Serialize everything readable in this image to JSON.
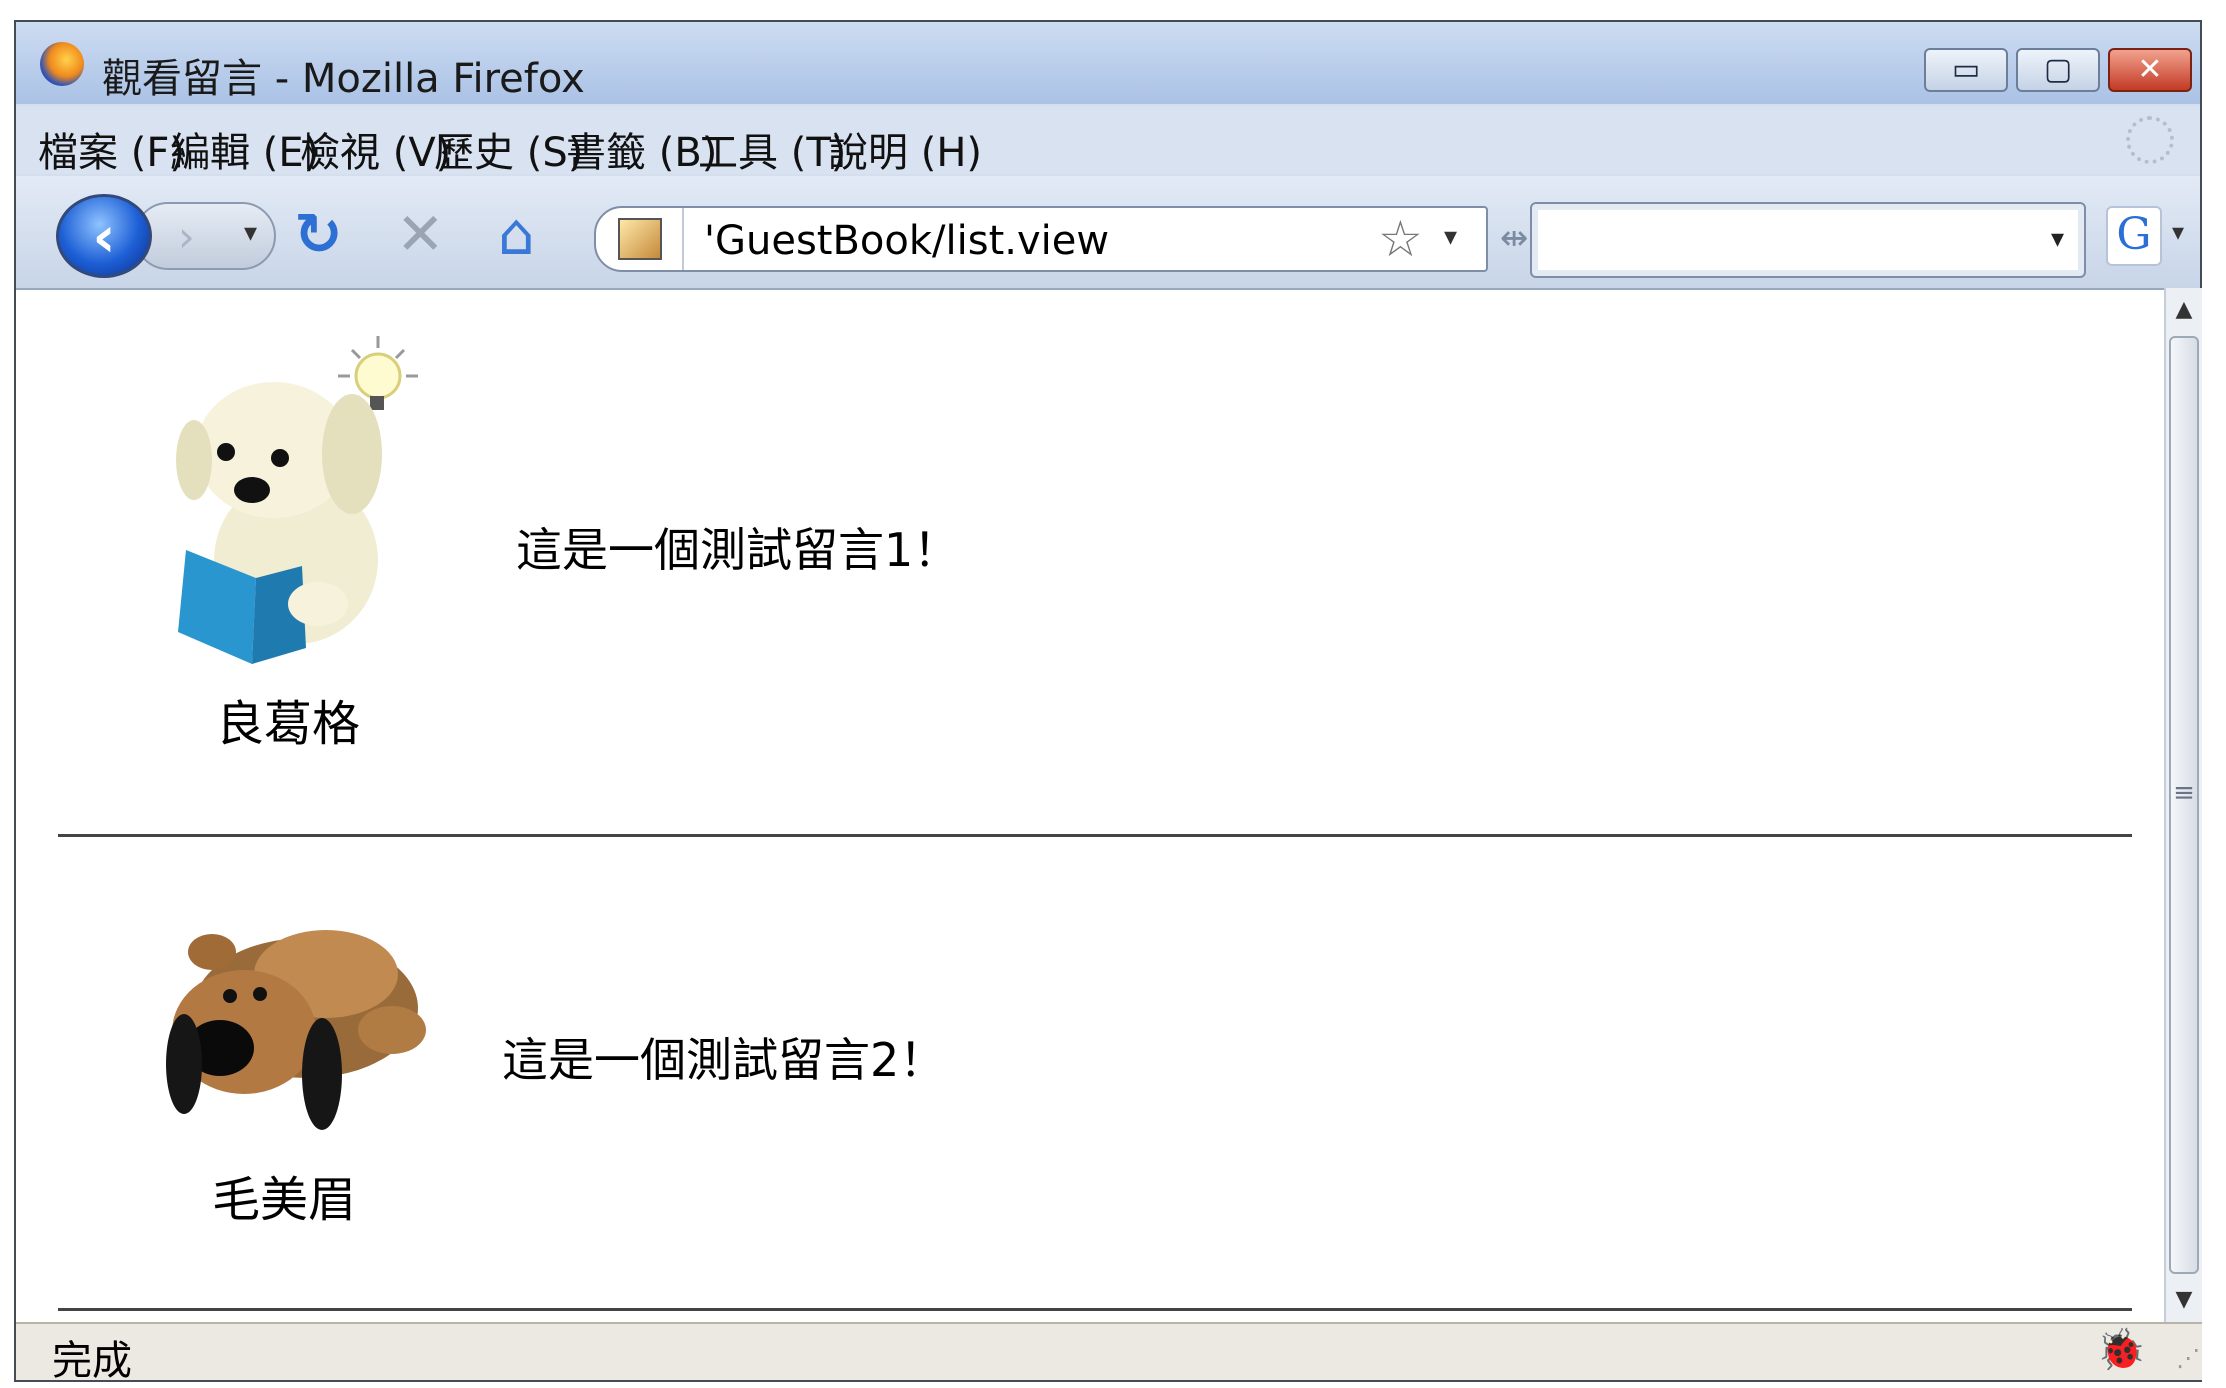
{
  "window": {
    "title": "觀看留言 - Mozilla Firefox",
    "controls": {
      "minimize": "▭",
      "maximize": "▢",
      "close": "✕"
    }
  },
  "menu": {
    "items": [
      "檔案 (F)",
      "編輯 (E)",
      "檢視 (V)",
      "歷史 (S)",
      "書籤 (B)",
      "工具 (T)",
      "說明 (H)"
    ]
  },
  "navbar": {
    "back": "‹",
    "forward": "›",
    "dropdown": "▾",
    "reload": "↻",
    "stop": "✕",
    "home": "⌂",
    "url": "'GuestBook/list.view",
    "bookmark_star": "☆",
    "url_dropdown": "▾",
    "resizer": "⇹",
    "search_value": "",
    "search_dropdown": "▾",
    "search_engine": "G",
    "engine_dropdown": "▾"
  },
  "entries": [
    {
      "name": "良葛格",
      "message": "這是一個測試留言1！",
      "avatar": "cream-puppy-reading-book"
    },
    {
      "name": "毛美眉",
      "message": "這是一個測試留言2！",
      "avatar": "brown-puppy-lying"
    }
  ],
  "scrollbar": {
    "up": "▲",
    "down": "▼",
    "grip": "≡"
  },
  "statusbar": {
    "status": "完成",
    "firebug": "🐞",
    "grip": "⋰"
  }
}
